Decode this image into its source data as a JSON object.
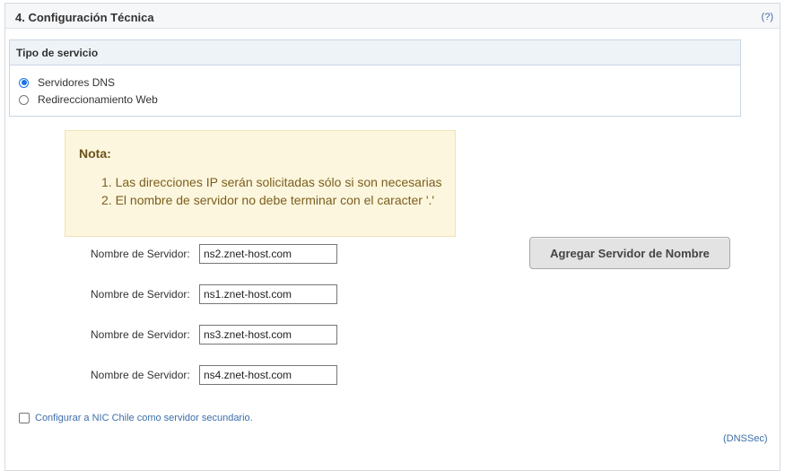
{
  "section": {
    "title": "4. Configuración Técnica",
    "help_link": "(?)"
  },
  "service_type": {
    "title": "Tipo de servicio",
    "options": [
      {
        "label": "Servidores DNS",
        "selected": true
      },
      {
        "label": "Redireccionamiento Web",
        "selected": false
      }
    ]
  },
  "note": {
    "title": "Nota:",
    "items": [
      "1. Las direcciones IP serán solicitadas sólo si son necesarias",
      "2. El nombre de servidor no debe terminar con el caracter '.'"
    ]
  },
  "name_servers": [
    {
      "label": "Nombre de Servidor:",
      "value": "ns2.znet-host.com"
    },
    {
      "label": "Nombre de Servidor:",
      "value": "ns1.znet-host.com"
    },
    {
      "label": "Nombre de Servidor:",
      "value": "ns3.znet-host.com"
    },
    {
      "label": "Nombre de Servidor:",
      "value": "ns4.znet-host.com"
    }
  ],
  "add_button_label": "Agregar Servidor de Nombre",
  "secondary_checkbox": {
    "label": "Configurar a NIC Chile como servidor secundario.",
    "checked": false
  },
  "dnssec_link": "(DNSSec)",
  "colors": {
    "accent": "#1a73e8",
    "link": "#3d6ea8",
    "note_background": "#fdf6de"
  }
}
